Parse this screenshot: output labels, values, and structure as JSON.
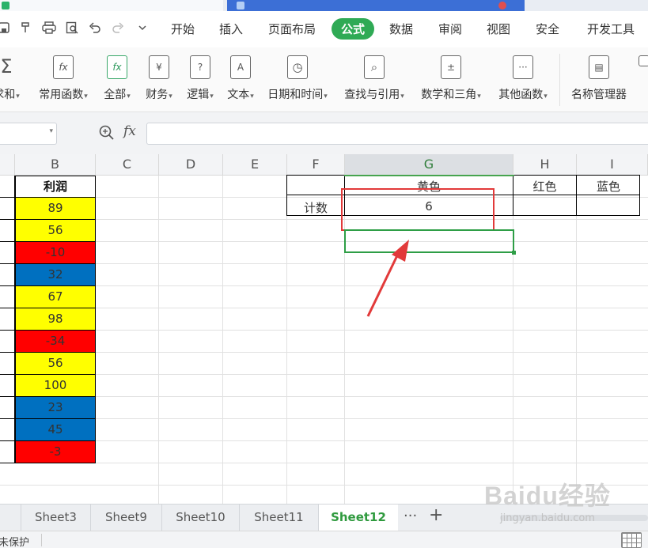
{
  "menu": {
    "tabs": [
      {
        "label": "开始",
        "active": false
      },
      {
        "label": "插入",
        "active": false
      },
      {
        "label": "页面布局",
        "active": false
      },
      {
        "label": "公式",
        "active": true
      },
      {
        "label": "数据",
        "active": false
      },
      {
        "label": "审阅",
        "active": false
      },
      {
        "label": "视图",
        "active": false
      },
      {
        "label": "安全",
        "active": false
      },
      {
        "label": "开发工具",
        "active": false
      }
    ]
  },
  "ribbon": {
    "buttons": [
      {
        "label": "求和",
        "icon": "sum-icon",
        "glyph": "Σ"
      },
      {
        "label": "常用函数",
        "icon": "common-functions-icon",
        "glyph": "fx"
      },
      {
        "label": "全部",
        "icon": "all-functions-icon",
        "glyph": "fx"
      },
      {
        "label": "财务",
        "icon": "finance-icon",
        "glyph": "¥"
      },
      {
        "label": "逻辑",
        "icon": "logic-icon",
        "glyph": "?"
      },
      {
        "label": "文本",
        "icon": "text-icon",
        "glyph": "A"
      },
      {
        "label": "日期和时间",
        "icon": "datetime-icon",
        "glyph": "◷"
      },
      {
        "label": "查找与引用",
        "icon": "lookup-icon",
        "glyph": "⌕"
      },
      {
        "label": "数学和三角",
        "icon": "math-icon",
        "glyph": "±"
      },
      {
        "label": "其他函数",
        "icon": "other-functions-icon",
        "glyph": "···"
      },
      {
        "label": "名称管理器",
        "icon": "name-manager-icon",
        "glyph": "▤"
      }
    ]
  },
  "formula_bar": {
    "fx_label": "fx",
    "value": ""
  },
  "sheet": {
    "columns": [
      "B",
      "C",
      "D",
      "E",
      "F",
      "G",
      "H",
      "I"
    ],
    "selected_column": "G",
    "profit_header": "利润",
    "profit_values": [
      {
        "value": "89",
        "color": "#ffff00"
      },
      {
        "value": "56",
        "color": "#ffff00"
      },
      {
        "value": "-10",
        "color": "#ff0000"
      },
      {
        "value": "32",
        "color": "#0070c0"
      },
      {
        "value": "67",
        "color": "#ffff00"
      },
      {
        "value": "98",
        "color": "#ffff00"
      },
      {
        "value": "-34",
        "color": "#ff0000"
      },
      {
        "value": "56",
        "color": "#ffff00"
      },
      {
        "value": "100",
        "color": "#ffff00"
      },
      {
        "value": "23",
        "color": "#0070c0"
      },
      {
        "value": "45",
        "color": "#0070c0"
      },
      {
        "value": "-3",
        "color": "#ff0000"
      }
    ],
    "count_label": "计数",
    "color_headers": [
      "黄色",
      "红色",
      "蓝色"
    ],
    "yellow_count": "6"
  },
  "sheet_tabs": [
    {
      "label": "Sheet3",
      "active": false
    },
    {
      "label": "Sheet9",
      "active": false
    },
    {
      "label": "Sheet10",
      "active": false
    },
    {
      "label": "Sheet11",
      "active": false
    },
    {
      "label": "Sheet12",
      "active": true
    }
  ],
  "tab_controls": {
    "more": "···",
    "add": "+"
  },
  "status": {
    "protection": "未保护"
  },
  "watermark": {
    "brand": "Baidu经验",
    "sub": "jingyan.baidu.com"
  },
  "colors": {
    "accent_green": "#2faa55",
    "annotation_red": "#e23a3a"
  }
}
